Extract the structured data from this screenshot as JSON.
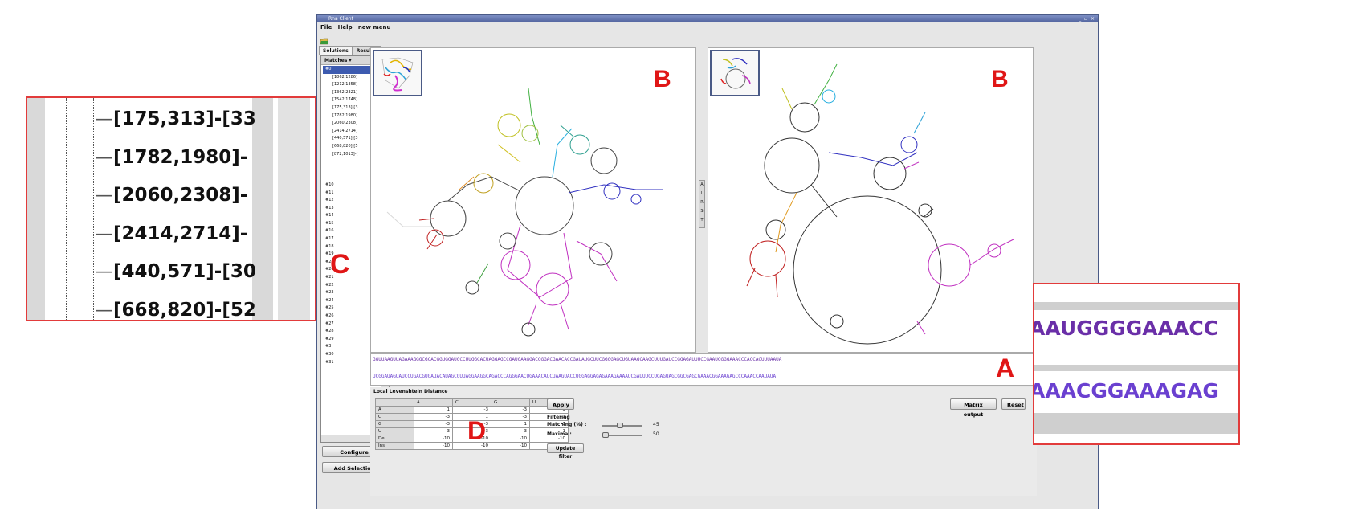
{
  "window": {
    "title": "Rna Client",
    "controls": "_ ▫ ×",
    "menu": [
      "File",
      "Help",
      "new menu"
    ]
  },
  "tabs": [
    "Solutions",
    "Results"
  ],
  "tree": {
    "header": "Matches",
    "items": [
      "#0",
      "[1862,1286]",
      "[1212,1358]",
      "[1362,2321]",
      "[1542,1748]",
      "[175,313]-[3",
      "[1782,1980]",
      "[2060,2308]",
      "[2414,2714]",
      "[440,571]-[3",
      "[668,820]-[5",
      "[872,1013]-[",
      "",
      "",
      "",
      "#10",
      "#11",
      "#12",
      "#13",
      "#14",
      "#15",
      "#16",
      "#17",
      "#18",
      "#19",
      "#2",
      "#20",
      "#21",
      "#22",
      "#23",
      "#24",
      "#25",
      "#26",
      "#27",
      "#28",
      "#29",
      "#3",
      "#30",
      "#31"
    ]
  },
  "buttons": {
    "configure": "Configure",
    "add_selection": "Add Selection",
    "apply": "Apply",
    "matrix_output": "Matrix output",
    "reset": "Reset",
    "update_filter": "Update filter"
  },
  "vertical_controls": "A L R S T",
  "sequences": {
    "seq1": "GGUUAAGUUAGAAAGGGCGCACGGUGGAUGCCUUGGCACUAGGAGCCGAUGAAGGACGGGACGAACACCGAUAUGCUUCGGGGAGCUGUAAGCAAGCUUUGAUCCGGAGAUUUCCGAAUGGGGAAACCCACCACUUUAAUA",
    "seq2": "UCGGAUAGUAUCCUGACGUGAUACAUAGCGUUAGGAAGGCAGACCCAGGGAACUGAAACAUCUAAGUACCUGGAGGAGAGAAAGAAAAUCGAUUUCCUGAGUAGCGGCGAGCGAAACGGAAAGAGCCCAAACCAAUAUA"
  },
  "distance": {
    "title": "Local Levenshtein Distance",
    "columns": [
      "",
      "A",
      "C",
      "G",
      "U"
    ],
    "rows": [
      [
        "A",
        "1",
        "-3",
        "-3",
        "-3"
      ],
      [
        "C",
        "-3",
        "1",
        "-3",
        "-3"
      ],
      [
        "G",
        "-3",
        "-3",
        "1",
        "-3"
      ],
      [
        "U",
        "-3",
        "-3",
        "-3",
        "1"
      ],
      [
        "Del",
        "-10",
        "-10",
        "-10",
        "-10"
      ],
      [
        "Ins",
        "-10",
        "-10",
        "-10",
        "-10"
      ]
    ]
  },
  "filtering": {
    "title": "Filtering",
    "matching_label": "Matching (%) :",
    "matching_value": "45",
    "matching_fraction": 0.45,
    "maxima_label": "Maxima :",
    "maxima_value": "50",
    "maxima_fraction": 0.05
  },
  "annotations": {
    "A": "A",
    "B": "B",
    "C": "C",
    "D": "D"
  },
  "zoom_c": {
    "items": [
      "[175,313]-[33",
      "[1782,1980]-",
      "[2060,2308]-",
      "[2414,2714]-",
      "[440,571]-[30",
      "[668,820]-[52"
    ]
  },
  "zoom_a": {
    "seq1": "AAUGGGGAAACC",
    "seq2": "AAACGGAAAGAG"
  },
  "colors": {
    "accent_red": "#e01616",
    "seq1": "#6a2fa8",
    "seq2": "#6a40d0",
    "window_title": "#51639e",
    "tree_selected": "#3d5bb0"
  }
}
